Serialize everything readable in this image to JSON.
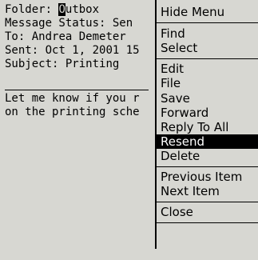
{
  "message": {
    "folder_key": "Folder:",
    "folder_first": "O",
    "folder_rest": "utbox",
    "status_key": "Message Status:",
    "status_value": "Sen",
    "to_key": "To:",
    "to_value": "Andrea Demeter",
    "sent_key": "Sent:",
    "sent_value": "Oct 1, 2001 15",
    "subject_key": "Subject:",
    "subject_value": "Printing",
    "body_lines": [
      "Let me know if you r",
      "on the printing sche"
    ]
  },
  "menu": {
    "items": [
      "Hide Menu",
      "Find",
      "Select",
      "Edit",
      "File",
      "Save",
      "Forward",
      "Reply To All",
      "Resend",
      "Delete",
      "Previous Item",
      "Next Item",
      "Close"
    ],
    "selected": "Resend"
  }
}
